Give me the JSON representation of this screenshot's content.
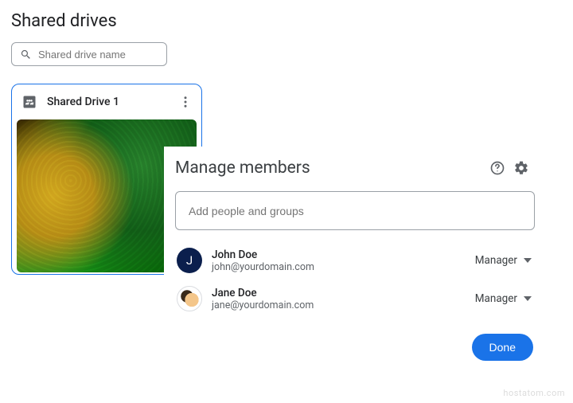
{
  "page": {
    "title": "Shared drives",
    "search_placeholder": "Shared drive name"
  },
  "drive": {
    "name": "Shared Drive 1"
  },
  "dialog": {
    "title": "Manage members",
    "add_placeholder": "Add people and groups",
    "done_label": "Done"
  },
  "members": [
    {
      "name": "John Doe",
      "email": "john@yourdomain.com",
      "role": "Manager",
      "initial": "J"
    },
    {
      "name": "Jane Doe",
      "email": "jane@yourdomain.com",
      "role": "Manager",
      "initial": ""
    }
  ],
  "watermark": "hostatom.com"
}
